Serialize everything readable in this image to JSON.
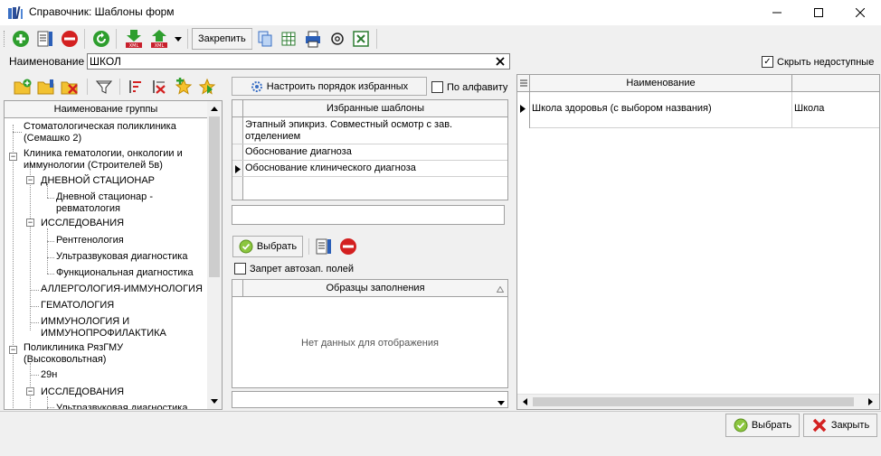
{
  "window": {
    "title": "Справочник: Шаблоны форм",
    "icon": "app-books-icon"
  },
  "toolbar": {
    "pin_label": "Закрепить"
  },
  "search": {
    "label": "Наименование",
    "value": "ШКОЛ",
    "hide_unavailable_label": "Скрыть недоступные",
    "hide_unavailable_checked": true
  },
  "groups": {
    "header": "Наименование группы",
    "items": [
      "Стоматологическая поликлиника (Семашко 2)",
      "Клиника гематологии, онкологии и иммунологии (Строителей 5в)",
      "ДНЕВНОЙ СТАЦИОНАР",
      "Дневной стационар - ревматология",
      "ИССЛЕДОВАНИЯ",
      "Рентгенология",
      "Ультразвуковая диагностика",
      "Функциональная диагностика",
      "АЛЛЕРГОЛОГИЯ-ИММУНОЛОГИЯ",
      "ГЕМАТОЛОГИЯ",
      "ИММУНОЛОГИЯ И ИММУНОПРОФИЛАКТИКА",
      "Поликлиника РязГМУ (Высоковольтная)",
      "29н",
      "ИССЛЕДОВАНИЯ",
      "Ультразвуковая диагностика"
    ]
  },
  "favorites": {
    "configure_label": "Настроить порядок избранных",
    "alpha_label": "По алфавиту",
    "alpha_checked": false,
    "header": "Избранные шаблоны",
    "rows": [
      "Этапный эпикриз. Совместный осмотр с зав. отделением",
      "Обоснование диагноза",
      "Обоснование клинического диагноза"
    ]
  },
  "samples": {
    "select_label": "Выбрать",
    "no_autofill_label": "Запрет автозап. полей",
    "no_autofill_checked": false,
    "header": "Образцы заполнения",
    "empty_text": "Нет данных для отображения"
  },
  "results": {
    "col1": "Наименование",
    "rows": [
      {
        "name": "Школа здоровья (с выбором названия)",
        "group": "Школа"
      }
    ]
  },
  "footer": {
    "select_label": "Выбрать",
    "close_label": "Закрыть"
  },
  "colors": {
    "accent_green": "#2e9e2e",
    "danger_red": "#d32020",
    "header_bg": "#f5f5f5"
  }
}
